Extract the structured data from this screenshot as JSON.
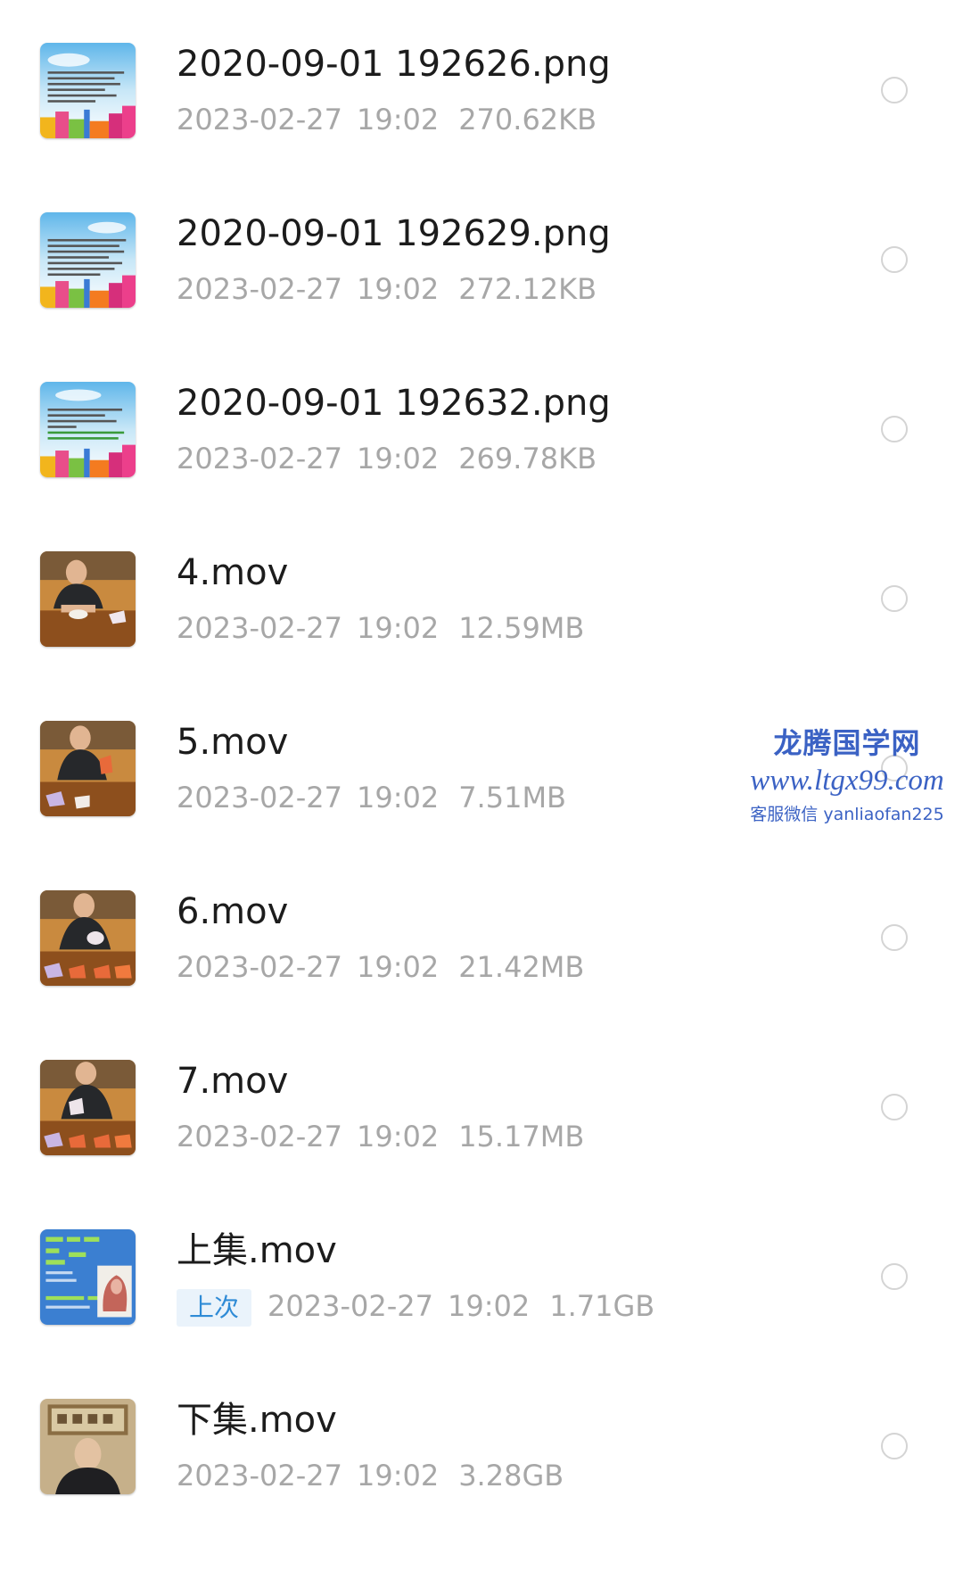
{
  "files": [
    {
      "name": "2020-09-01 192626.png",
      "date": "2023-02-27",
      "time": "19:02",
      "size": "270.62KB",
      "type": "image",
      "thumb_icon": "document-image-thumbnail"
    },
    {
      "name": "2020-09-01 192629.png",
      "date": "2023-02-27",
      "time": "19:02",
      "size": "272.12KB",
      "type": "image",
      "thumb_icon": "document-image-thumbnail"
    },
    {
      "name": "2020-09-01 192632.png",
      "date": "2023-02-27",
      "time": "19:02",
      "size": "269.78KB",
      "type": "image",
      "thumb_icon": "document-image-thumbnail"
    },
    {
      "name": "4.mov",
      "date": "2023-02-27",
      "time": "19:02",
      "size": "12.59MB",
      "type": "video",
      "thumb_icon": "video-thumbnail"
    },
    {
      "name": "5.mov",
      "date": "2023-02-27",
      "time": "19:02",
      "size": "7.51MB",
      "type": "video",
      "thumb_icon": "video-thumbnail"
    },
    {
      "name": "6.mov",
      "date": "2023-02-27",
      "time": "19:02",
      "size": "21.42MB",
      "type": "video",
      "thumb_icon": "video-thumbnail"
    },
    {
      "name": "7.mov",
      "date": "2023-02-27",
      "time": "19:02",
      "size": "15.17MB",
      "type": "video",
      "thumb_icon": "video-thumbnail"
    },
    {
      "name": "上集.mov",
      "badge": "上次",
      "date": "2023-02-27",
      "time": "19:02",
      "size": "1.71GB",
      "type": "video",
      "thumb_icon": "diagram-video-thumbnail"
    },
    {
      "name": "下集.mov",
      "date": "2023-02-27",
      "time": "19:02",
      "size": "3.28GB",
      "type": "video",
      "thumb_icon": "speaker-video-thumbnail"
    }
  ],
  "watermark": {
    "title": "龙腾国学网",
    "url": "www.ltgx99.com",
    "contact": "客服微信 yanliaofan225"
  },
  "colors": {
    "name_text": "#1c1c1c",
    "meta_text": "#a7a7a7",
    "badge_bg": "#eaf3fb",
    "badge_text": "#2f8bd6",
    "radio_border": "#d4d4d4",
    "watermark": "#3b62c4"
  }
}
